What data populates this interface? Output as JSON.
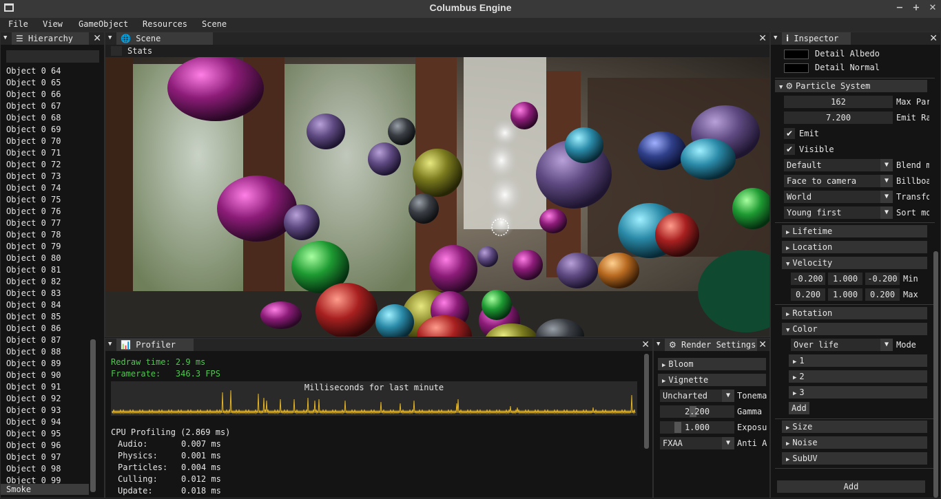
{
  "window": {
    "title": "Columbus Engine",
    "min": "−",
    "max": "+",
    "close": "✕"
  },
  "menu": [
    "File",
    "View",
    "GameObject",
    "Resources",
    "Scene"
  ],
  "hierarchy": {
    "tab": "Hierarchy",
    "items": [
      "Object 0 64",
      "Object 0 65",
      "Object 0 66",
      "Object 0 67",
      "Object 0 68",
      "Object 0 69",
      "Object 0 70",
      "Object 0 71",
      "Object 0 72",
      "Object 0 73",
      "Object 0 74",
      "Object 0 75",
      "Object 0 76",
      "Object 0 77",
      "Object 0 78",
      "Object 0 79",
      "Object 0 80",
      "Object 0 81",
      "Object 0 82",
      "Object 0 83",
      "Object 0 84",
      "Object 0 85",
      "Object 0 86",
      "Object 0 87",
      "Object 0 88",
      "Object 0 89",
      "Object 0 90",
      "Object 0 91",
      "Object 0 92",
      "Object 0 93",
      "Object 0 94",
      "Object 0 95",
      "Object 0 96",
      "Object 0 97",
      "Object 0 98",
      "Object 0 99"
    ],
    "selected": "Smoke"
  },
  "scene": {
    "tab": "Scene",
    "stats": "Stats"
  },
  "profiler": {
    "tab": "Profiler",
    "redraw": "Redraw time: 2.9 ms",
    "framerate": "Framerate:   346.3 FPS",
    "graph_title": "Milliseconds for last minute",
    "cpu": "CPU Profiling (2.869 ms)",
    "rows": [
      {
        "name": "Audio:",
        "value": "0.007 ms"
      },
      {
        "name": "Physics:",
        "value": "0.001 ms"
      },
      {
        "name": "Particles:",
        "value": "0.004 ms"
      },
      {
        "name": "Culling:",
        "value": "0.012 ms"
      },
      {
        "name": "Update:",
        "value": "0.018 ms"
      }
    ],
    "accent": "#4ec94e",
    "plot_color": "#e6b422"
  },
  "render": {
    "tab": "Render Settings",
    "bloom": "Bloom",
    "vignette": "Vignette",
    "tonemap_value": "Uncharted",
    "tonemap_label": "Tonema",
    "gamma_value": "2.200",
    "gamma_label": "Gamma",
    "exposure_value": "1.000",
    "exposure_label": "Exposu",
    "aa_value": "FXAA",
    "aa_label": "Anti A"
  },
  "inspector": {
    "tab": "Inspector",
    "detail_albedo": "Detail Albedo",
    "detail_normal": "Detail Normal",
    "particle_system": "Particle System",
    "max_particles": "162",
    "max_particles_label": "Max Par",
    "emit_rate": "7.200",
    "emit_rate_label": "Emit Ra",
    "emit": "Emit",
    "visible": "Visible",
    "blend_value": "Default",
    "blend_label": "Blend m",
    "billboard_value": "Face to camera",
    "billboard_label": "Billboa",
    "transform_value": "World",
    "transform_label": "Transfo",
    "sort_value": "Young first",
    "sort_label": "Sort mo",
    "lifetime": "Lifetime",
    "location": "Location",
    "velocity": "Velocity",
    "vel_min": [
      "-0.200",
      "1.000",
      "-0.200"
    ],
    "vel_min_label": "Min",
    "vel_max": [
      "0.200",
      "1.000",
      "0.200"
    ],
    "vel_max_label": "Max",
    "rotation": "Rotation",
    "color": "Color",
    "color_mode_value": "Over life",
    "color_mode_label": "Mode",
    "color_keys": [
      "1",
      "2",
      "3"
    ],
    "color_add": "Add",
    "size": "Size",
    "noise": "Noise",
    "subuv": "SubUV",
    "add_component": "Add"
  }
}
